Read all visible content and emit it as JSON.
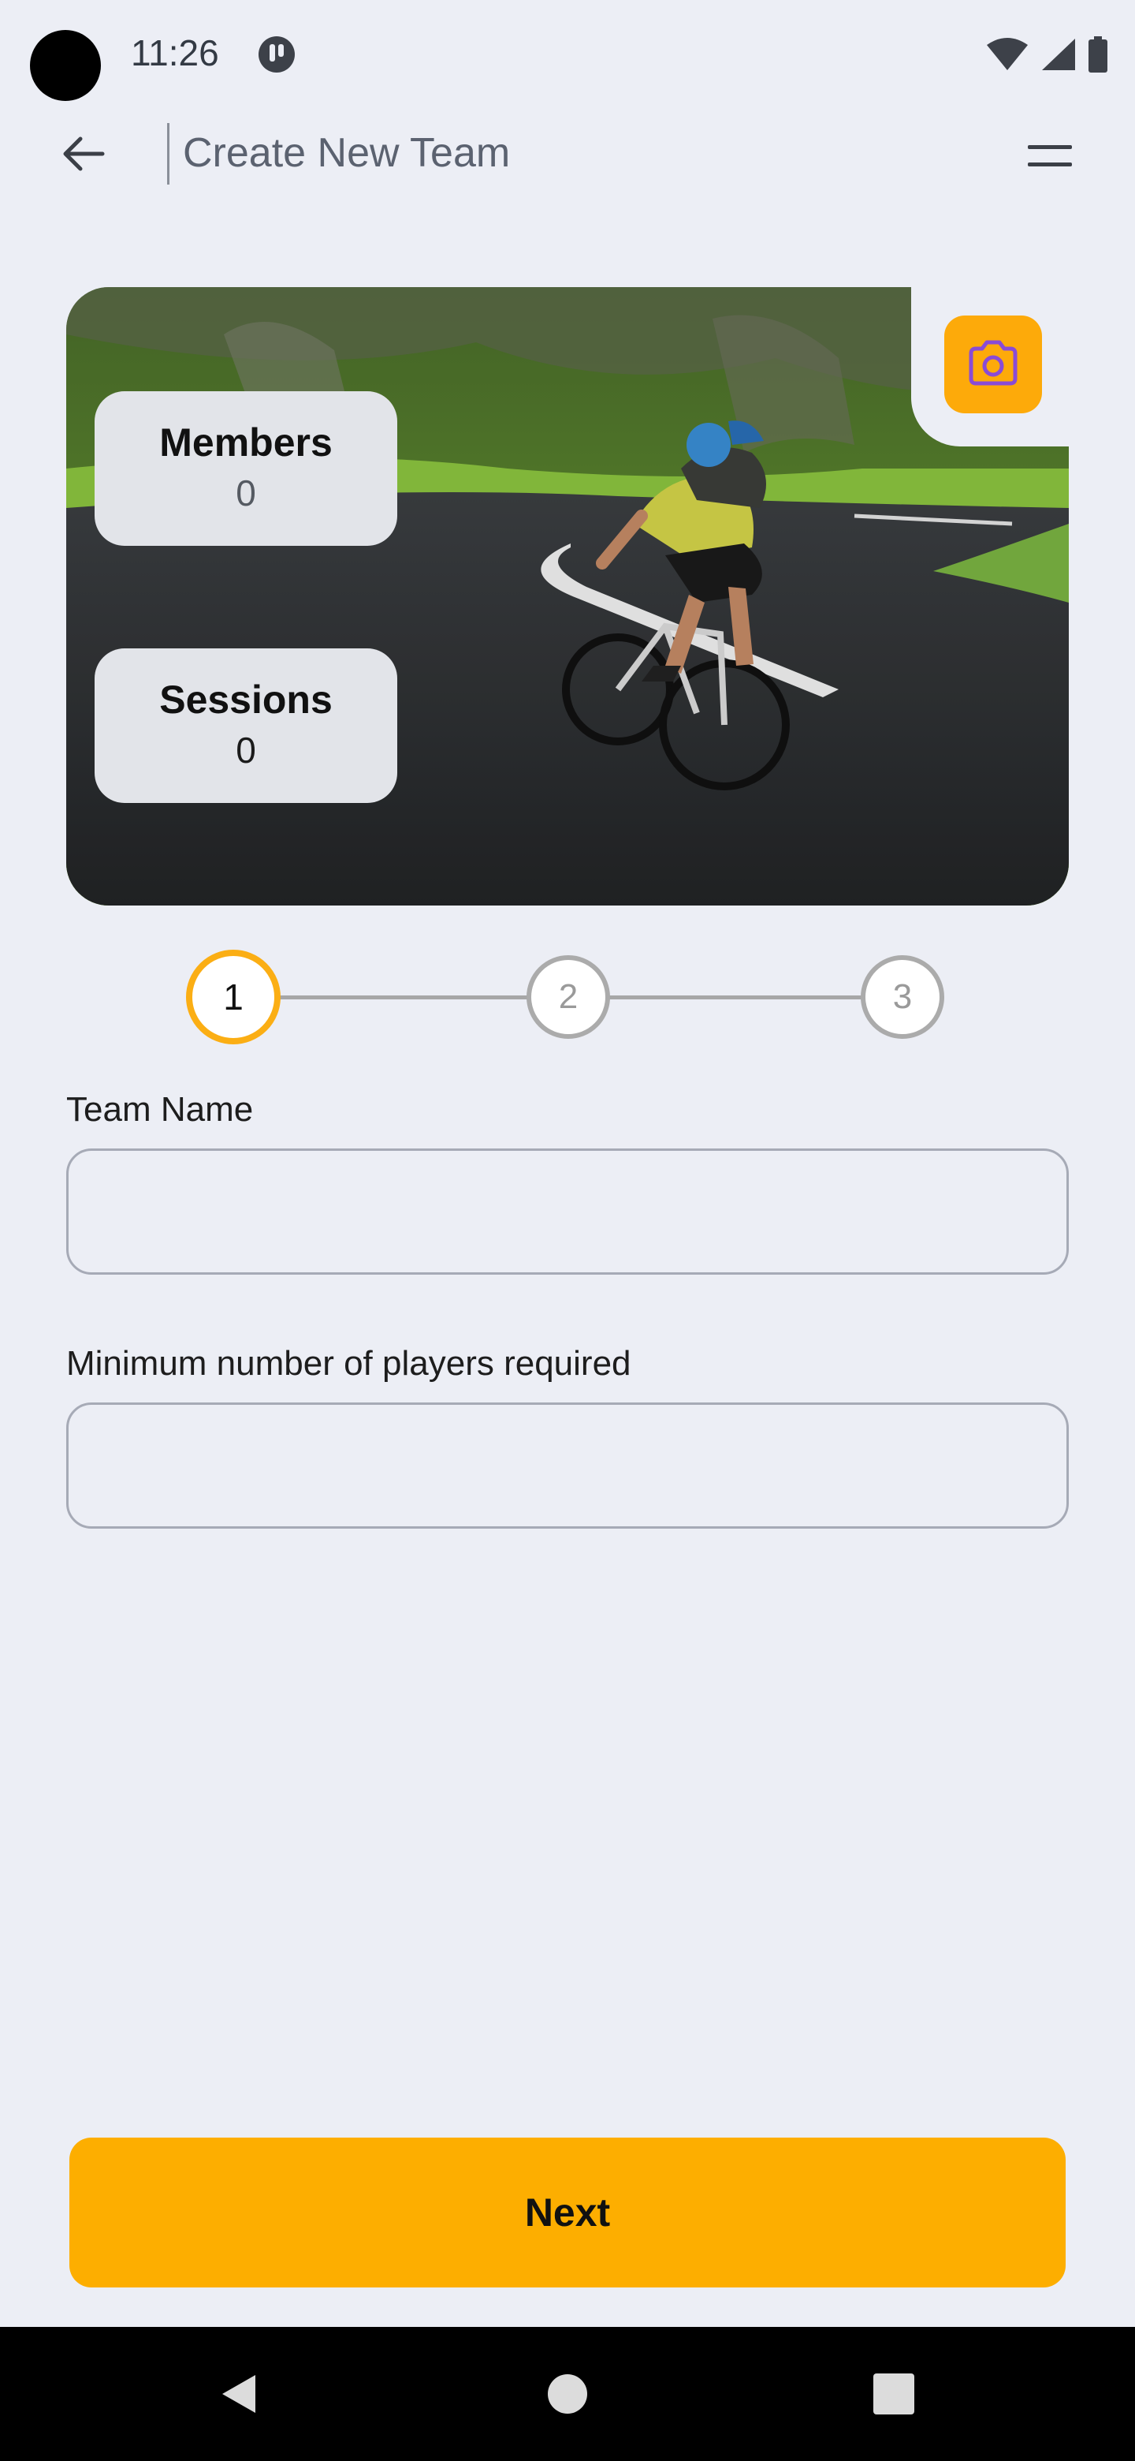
{
  "status_bar": {
    "time": "11:26",
    "icons": [
      "app-notification-icon",
      "wifi-icon",
      "cellular-signal-icon",
      "battery-icon"
    ]
  },
  "app_bar": {
    "title": "Create New Team",
    "back_icon": "arrow-left-icon",
    "menu_icon": "menu-icon"
  },
  "hero": {
    "camera_icon": "camera-icon",
    "stats": {
      "members": {
        "label": "Members",
        "value": "0"
      },
      "sessions": {
        "label": "Sessions",
        "value": "0"
      }
    }
  },
  "stepper": {
    "steps": [
      {
        "label": "1",
        "state": "active"
      },
      {
        "label": "2",
        "state": "inactive"
      },
      {
        "label": "3",
        "state": "inactive"
      }
    ],
    "current_step": 1
  },
  "form": {
    "team_name": {
      "label": "Team Name",
      "value": "",
      "placeholder": ""
    },
    "min_players": {
      "label": "Minimum number of players required",
      "value": "",
      "placeholder": ""
    }
  },
  "actions": {
    "next_label": "Next"
  },
  "colors": {
    "accent": "#fdae00",
    "background": "#eceef5",
    "camera_icon": "#8a4bd6"
  },
  "nav_bar": {
    "icons": [
      "back-triangle-icon",
      "home-circle-icon",
      "recents-square-icon"
    ]
  }
}
